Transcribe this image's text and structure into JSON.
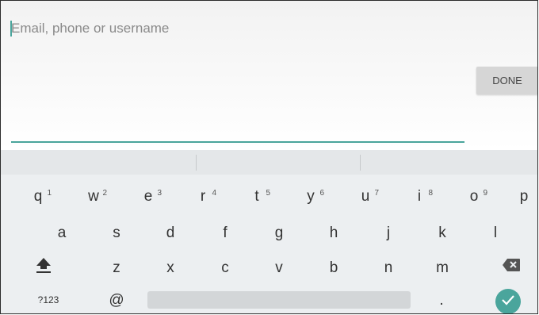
{
  "input": {
    "placeholder": "Email, phone or username",
    "done_label": "DONE"
  },
  "keyboard": {
    "row1": [
      {
        "key": "q",
        "hint": "1"
      },
      {
        "key": "w",
        "hint": "2"
      },
      {
        "key": "e",
        "hint": "3"
      },
      {
        "key": "r",
        "hint": "4"
      },
      {
        "key": "t",
        "hint": "5"
      },
      {
        "key": "y",
        "hint": "6"
      },
      {
        "key": "u",
        "hint": "7"
      },
      {
        "key": "i",
        "hint": "8"
      },
      {
        "key": "o",
        "hint": "9"
      },
      {
        "key": "p",
        "hint": ""
      }
    ],
    "row2": [
      "a",
      "s",
      "d",
      "f",
      "g",
      "h",
      "j",
      "k",
      "l"
    ],
    "row3": [
      "z",
      "x",
      "c",
      "v",
      "b",
      "n",
      "m"
    ],
    "symbols_label": "?123",
    "at_label": "@",
    "period_label": ".",
    "icons": {
      "shift": "shift-icon",
      "backspace": "backspace-icon",
      "enter": "checkmark-icon"
    }
  },
  "colors": {
    "accent": "#4aa59c",
    "keyboard_bg": "#eceff1",
    "done_bg": "#d6d6d6"
  }
}
